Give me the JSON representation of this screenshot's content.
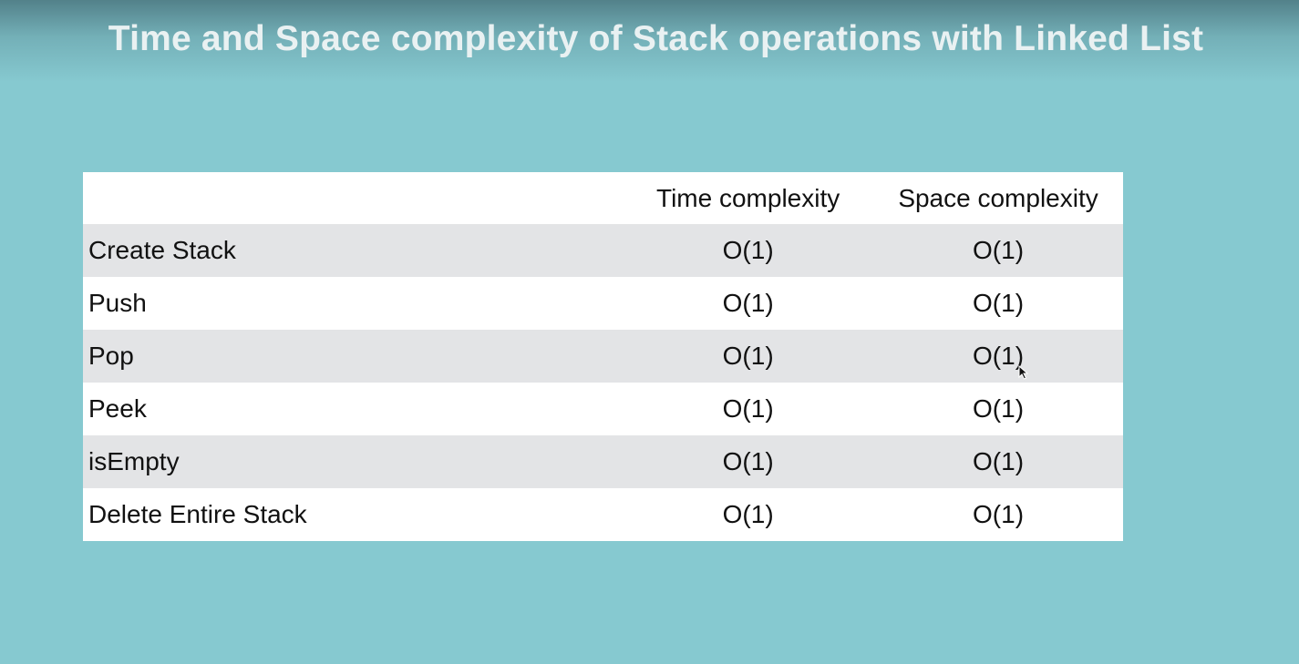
{
  "slide": {
    "title": "Time and Space complexity of Stack operations with Linked List"
  },
  "table": {
    "headers": [
      "",
      "Time complexity",
      "Space complexity"
    ],
    "rows": [
      {
        "operation": "Create Stack",
        "time": "O(1)",
        "space": "O(1)"
      },
      {
        "operation": "Push",
        "time": "O(1)",
        "space": "O(1)"
      },
      {
        "operation": "Pop",
        "time": "O(1)",
        "space": "O(1)"
      },
      {
        "operation": "Peek",
        "time": "O(1)",
        "space": "O(1)"
      },
      {
        "operation": "isEmpty",
        "time": "O(1)",
        "space": "O(1)"
      },
      {
        "operation": "Delete Entire Stack",
        "time": "O(1)",
        "space": "O(1)"
      }
    ]
  },
  "colors": {
    "background": "#86c9d0",
    "title": "#e9f1f2",
    "row_shaded": "#e3e4e6",
    "row_plain": "#ffffff"
  },
  "icons": {
    "cursor": "mouse-pointer-icon"
  }
}
